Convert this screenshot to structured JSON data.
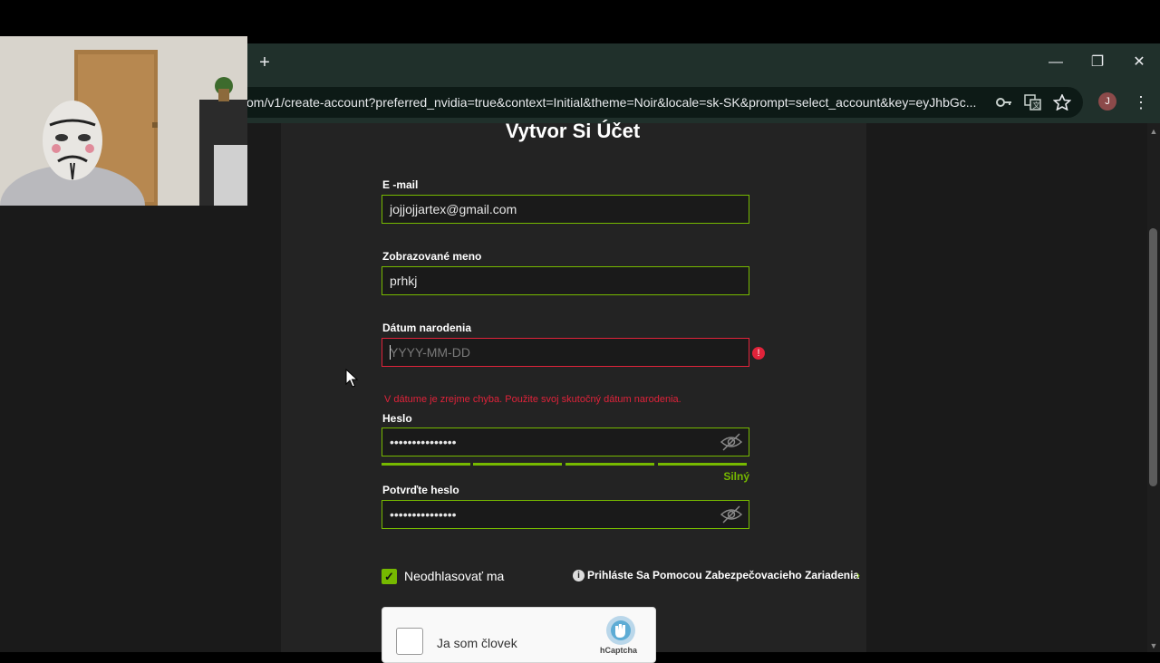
{
  "browser": {
    "new_tab": "+",
    "window_controls": {
      "minimize": "—",
      "restore": "❐",
      "close": "✕"
    },
    "url": "om/v1/create-account?preferred_nvidia=true&context=Initial&theme=Noir&locale=sk-SK&prompt=select_account&key=eyJhbGc...",
    "profile_initial": "J",
    "menu": "⋮",
    "icons": [
      "key-icon",
      "translate-icon",
      "star-icon"
    ]
  },
  "form": {
    "title": "Vytvor Si Účet",
    "email": {
      "label": "E -mail",
      "value": "jojjojjartex@gmail.com"
    },
    "display_name": {
      "label": "Zobrazované meno",
      "value": "prhkj"
    },
    "birthdate": {
      "label": "Dátum narodenia",
      "placeholder": "YYYY-MM-DD",
      "error": "V dátume je zrejme chyba. Použite svoj skutočný dátum narodenia."
    },
    "password": {
      "label": "Heslo",
      "value": "•••••••••••••••",
      "strength_label": "Silný",
      "strength_segments_filled": 4,
      "strength_segments_total": 4
    },
    "confirm_password": {
      "label": "Potvrďte heslo",
      "value": "•••••••••••••••"
    },
    "remember_me": {
      "label": "Neodhlasovať ma",
      "checked": true
    },
    "security_device_link": "Prihláste Sa Pomocou Zabezpečovacieho Zariadenia",
    "captcha": {
      "label": "Ja som človek",
      "brand": "hCaptcha"
    }
  },
  "colors": {
    "accent": "#76b900",
    "error": "#e0233a",
    "panel": "#232323",
    "background": "#1a1a1a"
  }
}
